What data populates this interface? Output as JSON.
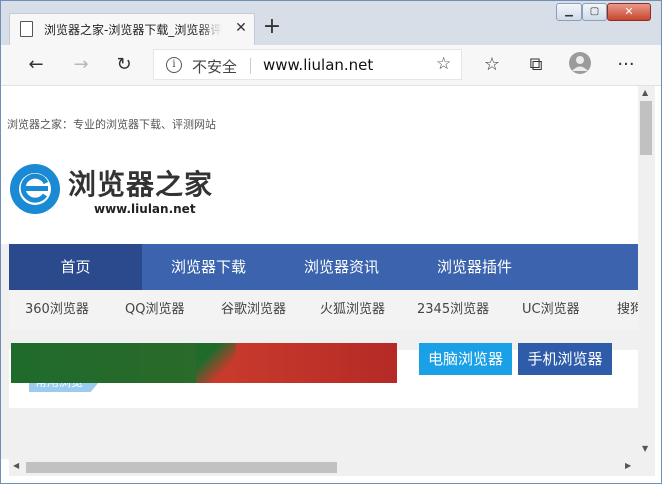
{
  "window": {
    "tab_title": "浏览器之家-浏览器下载_浏览器评测网站",
    "tab_close_glyph": "✕",
    "new_tab_glyph": "+",
    "controls": {
      "minimize": "▁",
      "maximize": "▢",
      "close": "✕"
    }
  },
  "toolbar": {
    "back_glyph": "←",
    "forward_glyph": "→",
    "refresh_glyph": "↻",
    "security_glyph": "i",
    "security_text": "不安全",
    "url": "www.liulan.net",
    "favorite_glyph": "☆",
    "favorites_list_glyph": "☆",
    "collections_glyph": "⧉",
    "more_glyph": "···"
  },
  "page": {
    "tagline": "浏览器之家：专业的浏览器下载、评测网站",
    "logo": {
      "name": "浏览器之家",
      "url": "www.liulan.net",
      "color": "#1a8ad4"
    },
    "nav": [
      "首页",
      "浏览器下载",
      "浏览器资讯",
      "浏览器插件"
    ],
    "subnav": [
      "360浏览器",
      "QQ浏览器",
      "谷歌浏览器",
      "火狐浏览器",
      "2345浏览器",
      "UC浏览器",
      "搜狗"
    ],
    "section_tag": "常用浏览",
    "buttons": {
      "pc": "电脑浏览器",
      "mobile": "手机浏览器"
    },
    "colors": {
      "nav": "#3c63ad",
      "nav_active": "#2a4a8d",
      "pc_button": "#1aa0e6",
      "mobile_button": "#2f5ca9"
    }
  },
  "scrollbars": {
    "up": "▲",
    "down": "▼",
    "left": "◀",
    "right": "▶"
  }
}
